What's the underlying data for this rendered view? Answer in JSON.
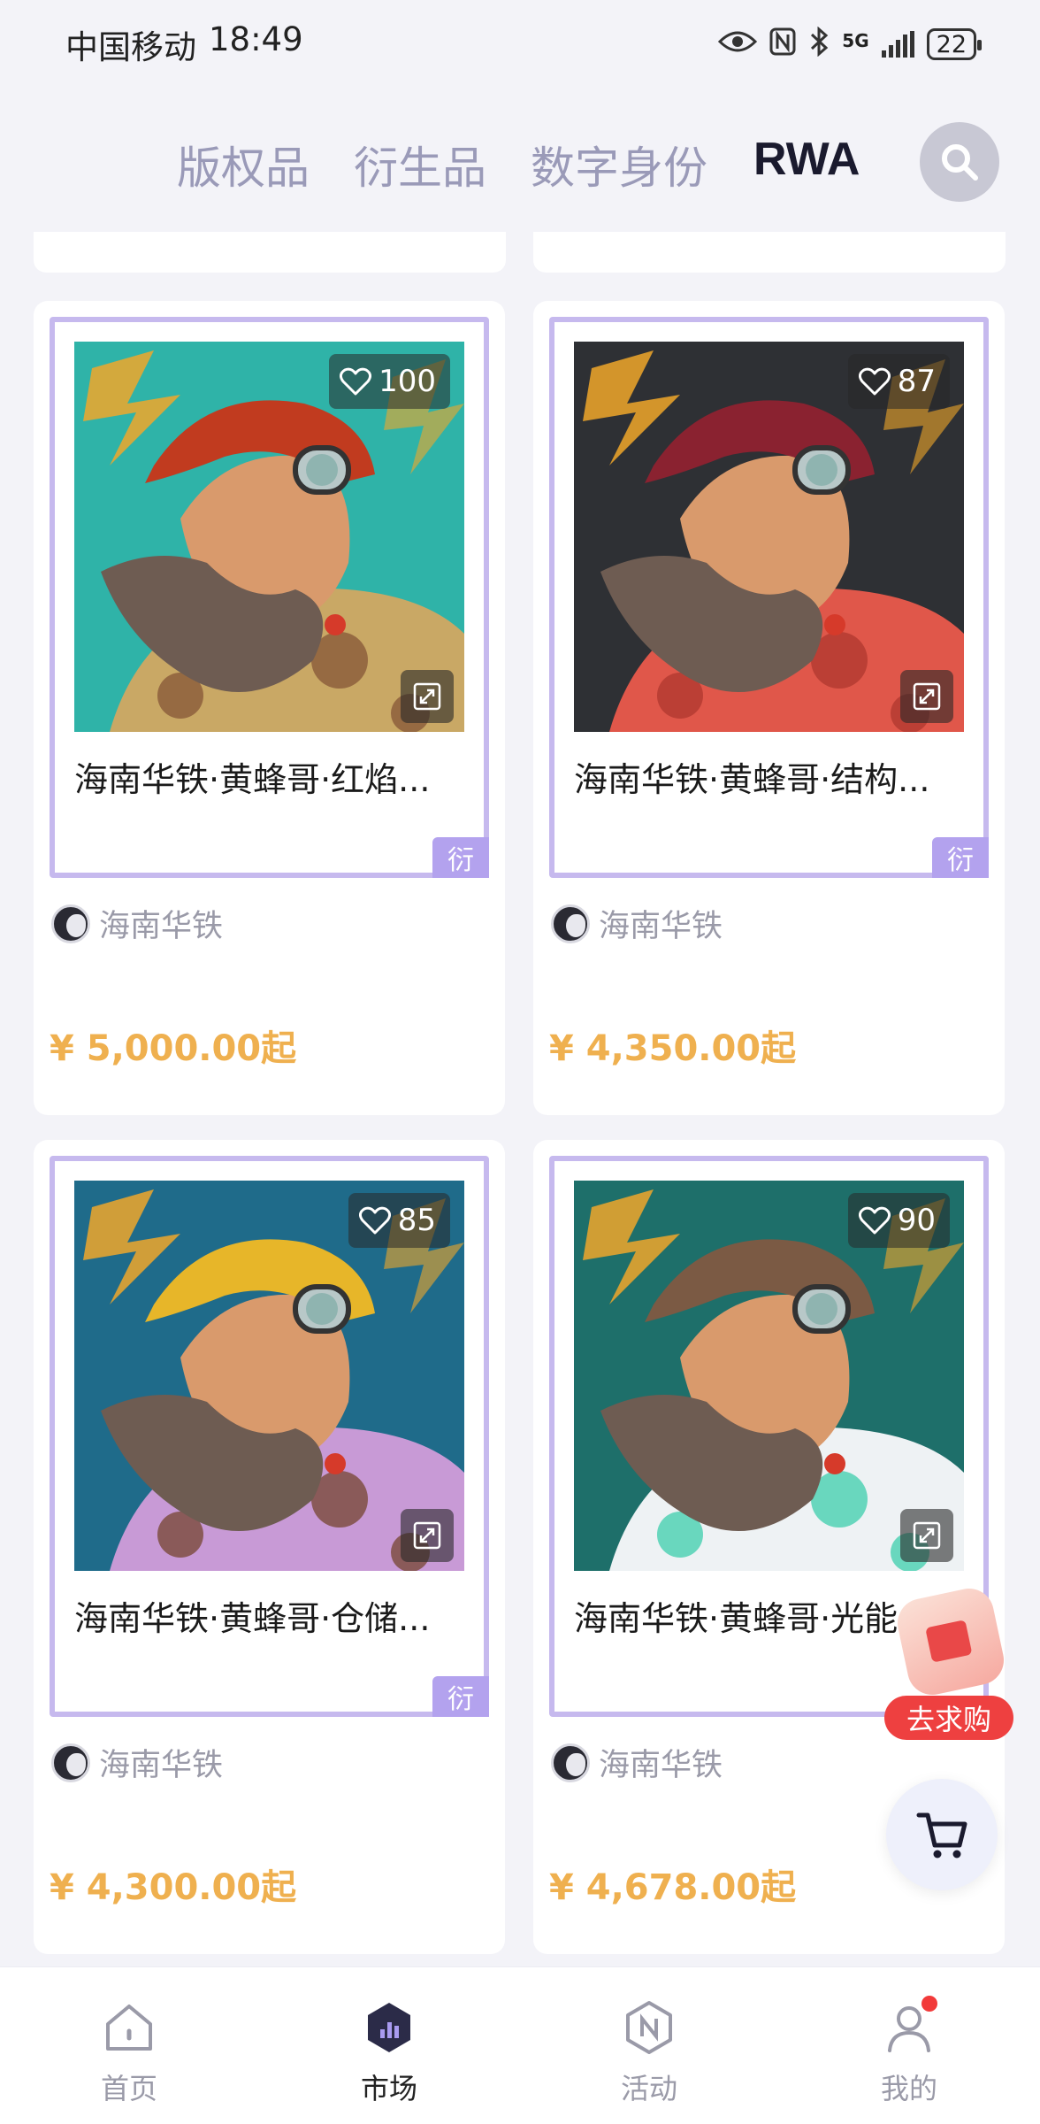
{
  "status_bar": {
    "carrier": "中国移动",
    "time": "18:49",
    "network": "5G",
    "battery": "22"
  },
  "tabs": [
    {
      "label": "版权品",
      "active": false
    },
    {
      "label": "衍生品",
      "active": false
    },
    {
      "label": "数字身份",
      "active": false
    },
    {
      "label": "RWA",
      "active": true
    }
  ],
  "items": [
    {
      "title": "海南华铁·黄蜂哥·红焰...",
      "likes": "100",
      "tag": "衍",
      "creator": "海南华铁",
      "price": "¥ 5,000.00起",
      "palette": {
        "bg": "#2fb3a8",
        "helmet": "#c13b1f",
        "shirt": "#c9a865",
        "spot": "#8a5a3a"
      }
    },
    {
      "title": "海南华铁·黄蜂哥·结构...",
      "likes": "87",
      "tag": "衍",
      "creator": "海南华铁",
      "price": "¥ 4,350.00起",
      "palette": {
        "bg": "#2e3034",
        "helmet": "#8a2230",
        "shirt": "#e0574a",
        "spot": "#b23a30"
      }
    },
    {
      "title": "海南华铁·黄蜂哥·仓储...",
      "likes": "85",
      "tag": "衍",
      "creator": "海南华铁",
      "price": "¥ 4,300.00起",
      "palette": {
        "bg": "#1f6b8a",
        "helmet": "#e7b629",
        "shirt": "#c89ad6",
        "spot": "#7a4a3a"
      }
    },
    {
      "title": "海南华铁·黄蜂哥·光能",
      "likes": "90",
      "tag": "",
      "creator": "海南华铁",
      "price": "¥ 4,678.00起",
      "palette": {
        "bg": "#1e6f6a",
        "helmet": "#7b5a44",
        "shirt": "#eef2f4",
        "spot": "#47d0b0"
      }
    }
  ],
  "floating": {
    "promo_label": "去求购"
  },
  "bottom_nav": [
    {
      "label": "首页",
      "active": false
    },
    {
      "label": "市场",
      "active": true
    },
    {
      "label": "活动",
      "active": false
    },
    {
      "label": "我的",
      "active": false
    }
  ]
}
